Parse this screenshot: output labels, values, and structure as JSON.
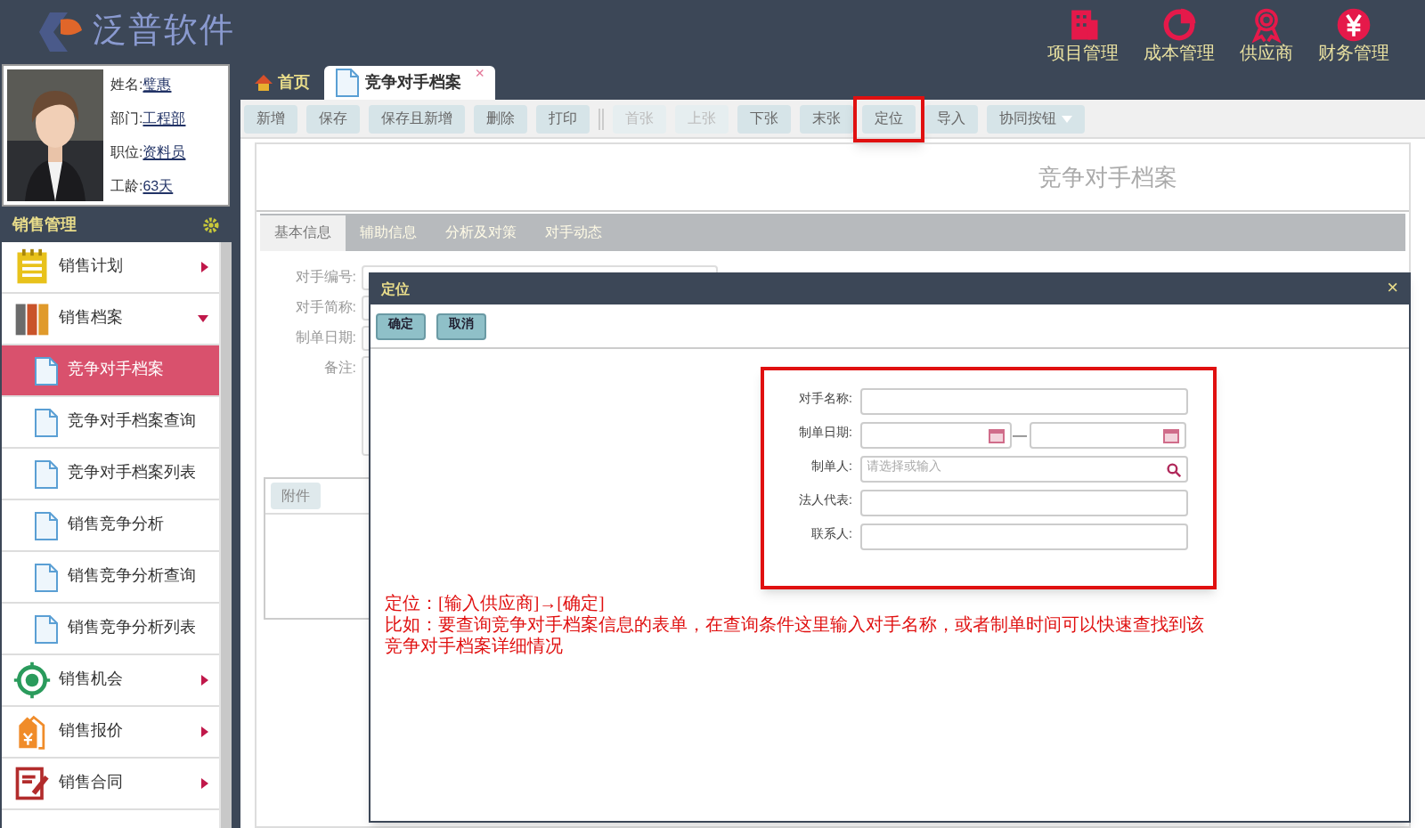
{
  "header": {
    "logo": "泛普软件",
    "modules": [
      {
        "label": "项目管理",
        "kind": "building"
      },
      {
        "label": "成本管理",
        "kind": "pie"
      },
      {
        "label": "供应商",
        "kind": "medal"
      },
      {
        "label": "财务管理",
        "kind": "yen"
      }
    ]
  },
  "profile": {
    "fields": [
      {
        "label": "姓名:",
        "value": "璧惠"
      },
      {
        "label": "部门:",
        "value": "工程部"
      },
      {
        "label": "职位:",
        "value": "资料员"
      },
      {
        "label": "工龄:",
        "value": "63天"
      }
    ]
  },
  "sidebar": {
    "title": "销售管理",
    "items": [
      {
        "label": "销售计划",
        "kind": "plan",
        "expanded": false
      },
      {
        "label": "销售档案",
        "kind": "archive",
        "expanded": true,
        "children": [
          {
            "label": "竞争对手档案",
            "selected": true
          },
          {
            "label": "竞争对手档案查询",
            "selected": false
          },
          {
            "label": "竞争对手档案列表",
            "selected": false
          },
          {
            "label": "销售竞争分析",
            "selected": false
          },
          {
            "label": "销售竞争分析查询",
            "selected": false
          },
          {
            "label": "销售竞争分析列表",
            "selected": false
          }
        ]
      },
      {
        "label": "销售机会",
        "kind": "target",
        "expanded": false
      },
      {
        "label": "销售报价",
        "kind": "tag",
        "expanded": false
      },
      {
        "label": "销售合同",
        "kind": "contract",
        "expanded": false
      }
    ]
  },
  "tabs": [
    {
      "label": "首页",
      "kind": "home",
      "selected": false,
      "closable": false
    },
    {
      "label": "竞争对手档案",
      "kind": "doc",
      "selected": true,
      "closable": true
    }
  ],
  "close_glyph": "×",
  "toolbar": [
    {
      "label": "新增",
      "disabled": false,
      "highlighted": false,
      "dropdown": false
    },
    {
      "label": "保存",
      "disabled": false,
      "highlighted": false,
      "dropdown": false
    },
    {
      "label": "保存且新增",
      "disabled": false,
      "highlighted": false,
      "dropdown": false
    },
    {
      "label": "删除",
      "disabled": false,
      "highlighted": false,
      "dropdown": false
    },
    {
      "label": "打印",
      "disabled": false,
      "highlighted": false,
      "dropdown": false
    },
    {
      "label": "首张",
      "disabled": true,
      "highlighted": false,
      "dropdown": false
    },
    {
      "label": "上张",
      "disabled": true,
      "highlighted": false,
      "dropdown": false
    },
    {
      "label": "下张",
      "disabled": false,
      "highlighted": false,
      "dropdown": false
    },
    {
      "label": "末张",
      "disabled": false,
      "highlighted": false,
      "dropdown": false
    },
    {
      "label": "定位",
      "disabled": false,
      "highlighted": true,
      "dropdown": false
    },
    {
      "label": "导入",
      "disabled": false,
      "highlighted": false,
      "dropdown": false
    },
    {
      "label": "协同按钮",
      "disabled": false,
      "highlighted": false,
      "dropdown": true
    }
  ],
  "form_title": "竞争对手档案",
  "form_tabs": [
    {
      "label": "基本信息",
      "selected": true
    },
    {
      "label": "辅助信息",
      "selected": false
    },
    {
      "label": "分析及对策",
      "selected": false
    },
    {
      "label": "对手动态",
      "selected": false
    }
  ],
  "form_fields": [
    {
      "label": "对手编号:"
    },
    {
      "label": "对手简称:"
    },
    {
      "label": "制单日期:"
    },
    {
      "label": "备注:"
    }
  ],
  "attachment_button": "附件",
  "dialog": {
    "title": "定位",
    "close_glyph": "×",
    "buttons": [
      "确定",
      "取消"
    ],
    "fields": [
      {
        "label": "对手名称:",
        "kind": "text"
      },
      {
        "label": "制单日期:",
        "kind": "daterange",
        "separator": "—"
      },
      {
        "label": "制单人:",
        "kind": "search",
        "placeholder": "请选择或输入"
      },
      {
        "label": "法人代表:",
        "kind": "text"
      },
      {
        "label": "联系人:",
        "kind": "text"
      }
    ],
    "note": [
      "定位：[输入供应商]→[确定]",
      "比如：要查询竞争对手档案信息的表单，在查询条件这里输入对手名称，或者制单时间可以快速查找到该",
      "竞争对手档案详细情况"
    ]
  }
}
